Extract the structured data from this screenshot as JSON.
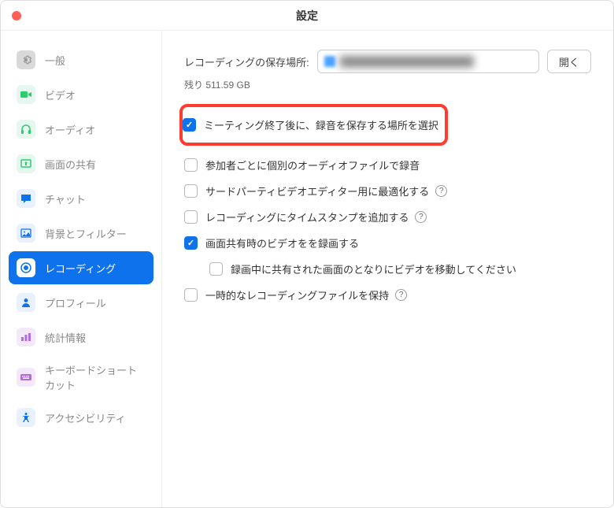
{
  "window": {
    "title": "設定"
  },
  "sidebar": {
    "items": [
      {
        "label": "一般",
        "iconBg": "#d9d9d9",
        "iconColor": "#999",
        "active": false,
        "name": "sidebar-item-general",
        "icon": "gear"
      },
      {
        "label": "ビデオ",
        "iconBg": "#e6f7ef",
        "iconColor": "#2ecc71",
        "active": false,
        "name": "sidebar-item-video",
        "icon": "video"
      },
      {
        "label": "オーディオ",
        "iconBg": "#e6f7ef",
        "iconColor": "#2ecc71",
        "active": false,
        "name": "sidebar-item-audio",
        "icon": "headphones"
      },
      {
        "label": "画面の共有",
        "iconBg": "#e6f7ef",
        "iconColor": "#2ecc71",
        "active": false,
        "name": "sidebar-item-share-screen",
        "icon": "share"
      },
      {
        "label": "チャット",
        "iconBg": "#e8f1fd",
        "iconColor": "#0E72ED",
        "active": false,
        "name": "sidebar-item-chat",
        "icon": "chat"
      },
      {
        "label": "背景とフィルター",
        "iconBg": "#e8f1fd",
        "iconColor": "#0E72ED",
        "active": false,
        "name": "sidebar-item-background",
        "icon": "image"
      },
      {
        "label": "レコーディング",
        "iconBg": "#ffffff",
        "iconColor": "#0E72ED",
        "active": true,
        "name": "sidebar-item-recording",
        "icon": "record"
      },
      {
        "label": "プロフィール",
        "iconBg": "#e8f1fd",
        "iconColor": "#0E72ED",
        "active": false,
        "name": "sidebar-item-profile",
        "icon": "person"
      },
      {
        "label": "統計情報",
        "iconBg": "#f3e9fb",
        "iconColor": "#b36ae2",
        "active": false,
        "name": "sidebar-item-statistics",
        "icon": "stats"
      },
      {
        "label": "キーボードショートカット",
        "iconBg": "#f3e9fb",
        "iconColor": "#b36ae2",
        "active": false,
        "name": "sidebar-item-keyboard",
        "icon": "keyboard"
      },
      {
        "label": "アクセシビリティ",
        "iconBg": "#e8f1fd",
        "iconColor": "#0E72ED",
        "active": false,
        "name": "sidebar-item-accessibility",
        "icon": "accessibility"
      }
    ]
  },
  "content": {
    "locationLabel": "レコーディングの保存場所:",
    "openButton": "開く",
    "remaining": "残り 511.59 GB",
    "options": [
      {
        "label": "ミーティング終了後に、録音を保存する場所を選択",
        "checked": true,
        "highlighted": true,
        "indented": false,
        "help": false,
        "name": "checkbox-choose-location"
      },
      {
        "label": "参加者ごとに個別のオーディオファイルで録音",
        "checked": false,
        "highlighted": false,
        "indented": false,
        "help": false,
        "name": "checkbox-separate-audio"
      },
      {
        "label": "サードパーティビデオエディター用に最適化する",
        "checked": false,
        "highlighted": false,
        "indented": false,
        "help": true,
        "name": "checkbox-optimize-editor"
      },
      {
        "label": "レコーディングにタイムスタンプを追加する",
        "checked": false,
        "highlighted": false,
        "indented": false,
        "help": true,
        "name": "checkbox-timestamp"
      },
      {
        "label": "画面共有時のビデオをを録画する",
        "checked": true,
        "highlighted": false,
        "indented": false,
        "help": false,
        "name": "checkbox-record-video"
      },
      {
        "label": "録画中に共有された画面のとなりにビデオを移動してください",
        "checked": false,
        "highlighted": false,
        "indented": true,
        "help": false,
        "name": "checkbox-move-video"
      },
      {
        "label": "一時的なレコーディングファイルを保持",
        "checked": false,
        "highlighted": false,
        "indented": false,
        "help": true,
        "name": "checkbox-keep-temp"
      }
    ]
  }
}
